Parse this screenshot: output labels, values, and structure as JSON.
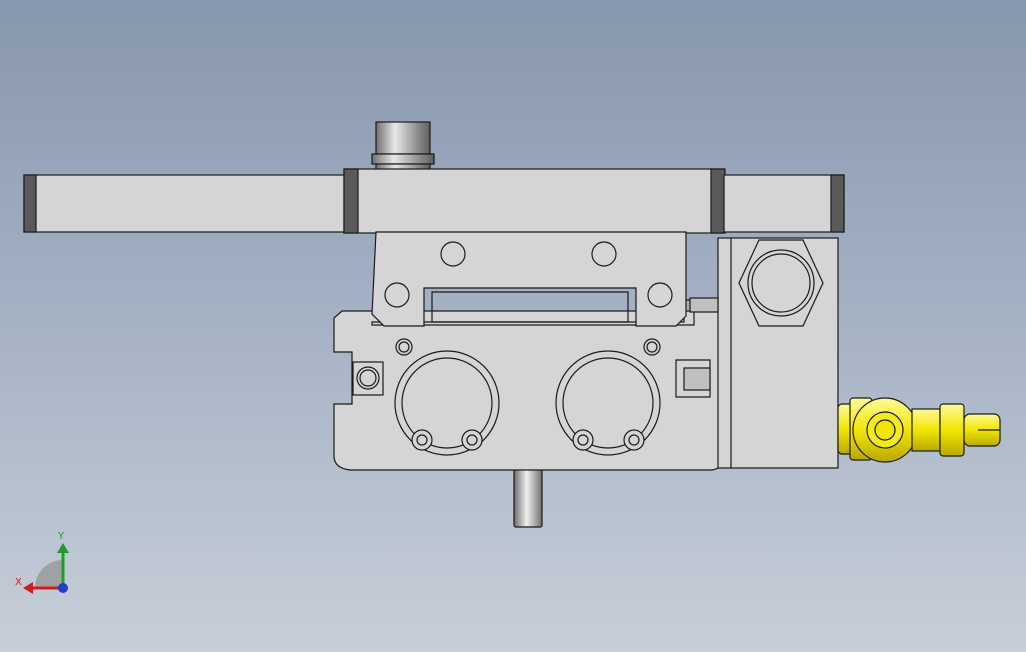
{
  "viewport": {
    "background_top": "#8797ad",
    "background_bottom": "#c7ced8"
  },
  "model": {
    "part_fill": "#d5d5d5",
    "edge_color": "#1a1a1a",
    "rubber_color": "#5a5a5a",
    "fitting_color": "#f2e600"
  },
  "triad": {
    "x_label": "X",
    "y_label": "Y",
    "x_color": "#cc1e1e",
    "y_color": "#1f9b2a",
    "z_color": "#1f3fcc"
  }
}
